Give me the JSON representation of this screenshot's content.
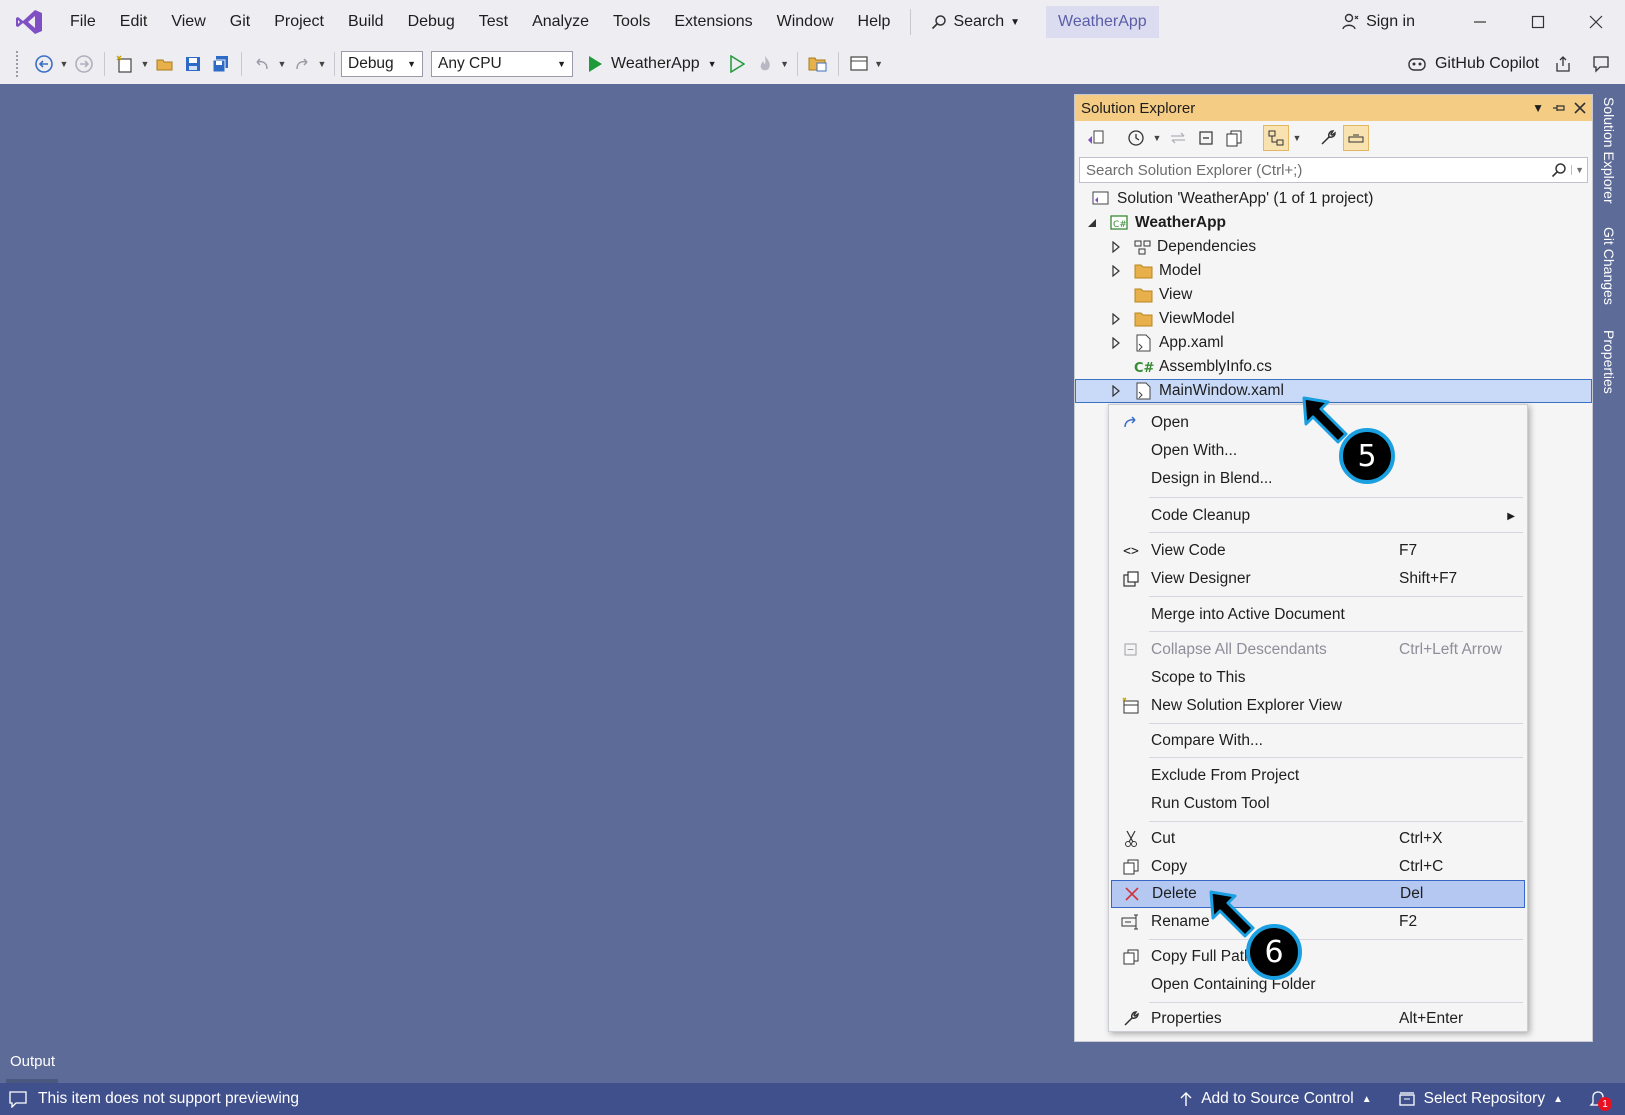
{
  "menu": {
    "items": [
      "File",
      "Edit",
      "View",
      "Git",
      "Project",
      "Build",
      "Debug",
      "Test",
      "Analyze",
      "Tools",
      "Extensions",
      "Window",
      "Help"
    ],
    "search_label": "Search",
    "app_badge": "WeatherApp",
    "sign_in": "Sign in"
  },
  "toolbar": {
    "config": "Debug",
    "platform": "Any CPU",
    "run_target": "WeatherApp",
    "copilot": "GitHub Copilot"
  },
  "solution_explorer": {
    "title": "Solution Explorer",
    "search_placeholder": "Search Solution Explorer (Ctrl+;)",
    "tree": [
      {
        "label": "Solution 'WeatherApp' (1 of 1 project)",
        "icon": "solution-icon"
      },
      {
        "label": "WeatherApp",
        "icon": "csharp-project-icon"
      },
      {
        "label": "Dependencies",
        "icon": "dependencies-icon"
      },
      {
        "label": "Model",
        "icon": "folder-icon"
      },
      {
        "label": "View",
        "icon": "folder-icon"
      },
      {
        "label": "ViewModel",
        "icon": "folder-icon"
      },
      {
        "label": "App.xaml",
        "icon": "xaml-file-icon"
      },
      {
        "label": "AssemblyInfo.cs",
        "icon": "csharp-file-icon"
      },
      {
        "label": "MainWindow.xaml",
        "icon": "xaml-file-icon",
        "selected": true
      }
    ]
  },
  "side_tabs": [
    "Solution Explorer",
    "Git Changes",
    "Properties"
  ],
  "context_menu": {
    "items": [
      {
        "label": "Open",
        "shortcut": "",
        "icon": "open-icon"
      },
      {
        "label": "Open With...",
        "shortcut": ""
      },
      {
        "label": "Design in Blend...",
        "shortcut": ""
      },
      {
        "label": "Code Cleanup",
        "shortcut": "",
        "submenu": true
      },
      {
        "label": "View Code",
        "shortcut": "F7",
        "icon": "code-icon"
      },
      {
        "label": "View Designer",
        "shortcut": "Shift+F7",
        "icon": "designer-icon"
      },
      {
        "label": "Merge into Active Document",
        "shortcut": ""
      },
      {
        "label": "Collapse All Descendants",
        "shortcut": "Ctrl+Left Arrow",
        "disabled": true,
        "icon": "collapse-icon"
      },
      {
        "label": "Scope to This",
        "shortcut": ""
      },
      {
        "label": "New Solution Explorer View",
        "shortcut": "",
        "icon": "new-view-icon"
      },
      {
        "label": "Compare With...",
        "shortcut": ""
      },
      {
        "label": "Exclude From Project",
        "shortcut": ""
      },
      {
        "label": "Run Custom Tool",
        "shortcut": ""
      },
      {
        "label": "Cut",
        "shortcut": "Ctrl+X",
        "icon": "cut-icon"
      },
      {
        "label": "Copy",
        "shortcut": "Ctrl+C",
        "icon": "copy-icon"
      },
      {
        "label": "Delete",
        "shortcut": "Del",
        "icon": "delete-icon",
        "highlighted": true
      },
      {
        "label": "Rename",
        "shortcut": "F2",
        "icon": "rename-icon"
      },
      {
        "label": "Copy Full Path",
        "shortcut": "",
        "icon": "copy-path-icon"
      },
      {
        "label": "Open Containing Folder",
        "shortcut": ""
      },
      {
        "label": "Properties",
        "shortcut": "Alt+Enter",
        "icon": "wrench-icon"
      }
    ]
  },
  "callouts": [
    "5",
    "6"
  ],
  "output_tab": "Output",
  "status": {
    "message": "This item does not support previewing",
    "add_source_control": "Add to Source Control",
    "select_repo": "Select Repository",
    "notification_count": "1"
  },
  "colors": {
    "accent": "#68217a",
    "main_bg": "#5d6b99",
    "status_bg": "#40508d",
    "tool_title": "#f5cc84",
    "callout_ring": "#1aa0e0"
  }
}
